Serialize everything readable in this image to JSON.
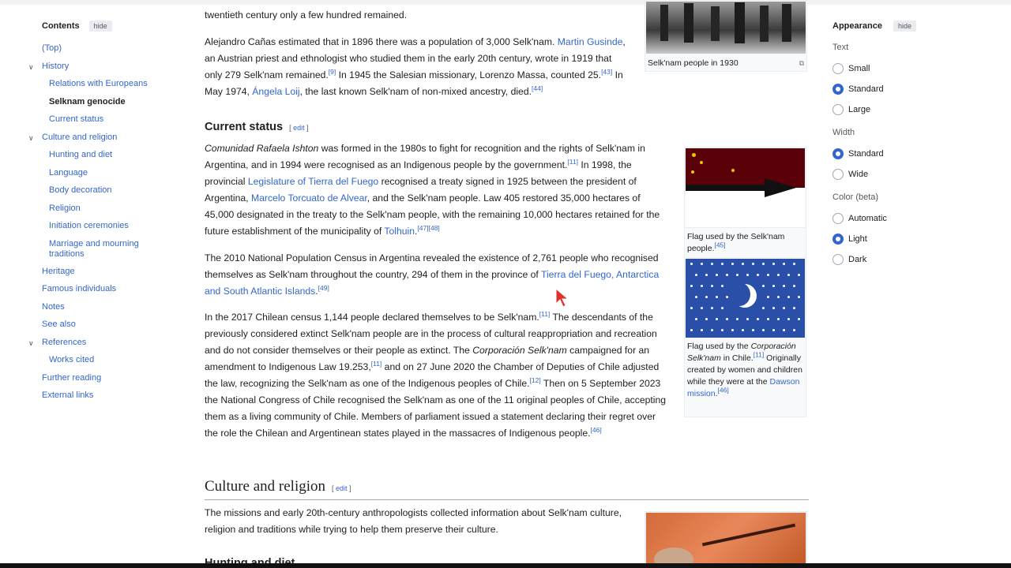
{
  "toc": {
    "title": "Contents",
    "hide": "hide",
    "items": [
      {
        "label": "(Top)",
        "level": "top"
      },
      {
        "label": "History",
        "level": "parent"
      },
      {
        "label": "Relations with Europeans",
        "level": "sub"
      },
      {
        "label": "Selknam genocide",
        "level": "sub-current"
      },
      {
        "label": "Current status",
        "level": "sub"
      },
      {
        "label": "Culture and religion",
        "level": "parent"
      },
      {
        "label": "Hunting and diet",
        "level": "sub"
      },
      {
        "label": "Language",
        "level": "sub"
      },
      {
        "label": "Body decoration",
        "level": "sub"
      },
      {
        "label": "Religion",
        "level": "sub"
      },
      {
        "label": "Initiation ceremonies",
        "level": "sub"
      },
      {
        "label": "Marriage and mourning traditions",
        "level": "sub-tall"
      },
      {
        "label": "Heritage",
        "level": "top"
      },
      {
        "label": "Famous individuals",
        "level": "top"
      },
      {
        "label": "Notes",
        "level": "top"
      },
      {
        "label": "See also",
        "level": "top"
      },
      {
        "label": "References",
        "level": "parent"
      },
      {
        "label": "Works cited",
        "level": "sub"
      },
      {
        "label": "Further reading",
        "level": "top"
      },
      {
        "label": "External links",
        "level": "top"
      }
    ]
  },
  "article": {
    "p0_tail": "twentieth century only a few hundred remained.",
    "p1": {
      "a": "Alejandro Cañas estimated that in 1896 there was a population of 3,000 Selk'nam. ",
      "link1": "Martin Gusinde",
      "b": ", an Austrian priest and ethnologist who studied them in the early 20th century, wrote in 1919 that only 279 Selk'nam remained.",
      "ref1": "[9]",
      "c": " In 1945 the Salesian missionary, Lorenzo Massa, counted 25.",
      "ref2": "[43]",
      "d": " In May 1974, ",
      "link2": "Ángela Loij",
      "e": ", the last known Selk'nam of non-mixed ancestry, died.",
      "ref3": "[44]"
    },
    "current_status": {
      "heading": "Current status",
      "edit_open": "[ ",
      "edit": "edit",
      "edit_close": " ]"
    },
    "p2": {
      "italic": "Comunidad Rafaela Ishton",
      "a": " was formed in the 1980s to fight for recognition and the rights of Selk'nam in Argentina, and in 1994 were recognised as an Indigenous people by the government.",
      "ref1": "[11]",
      "b": " In 1998, the provincial ",
      "link1": "Legislature of Tierra del Fuego",
      "c": " recognised a treaty signed in 1925 between the president of Argentina, ",
      "link2": "Marcelo Torcuato de Alvear",
      "d": ", and the Selk'nam people. Law 405 restored 35,000 hectares of 45,000 designated in the treaty to the Selk'nam people, with the remaining 10,000 hectares retained for the future establishment of the municipality of ",
      "link3": "Tolhuin",
      "e": ".",
      "ref2": "[47][48]"
    },
    "p3": {
      "a": "The 2010 National Population Census in Argentina revealed the existence of 2,761 people who recognised themselves as Selk'nam throughout the country, 294 of them in the province of ",
      "link1": "Tierra del Fuego, Antarctica and South Atlantic Islands",
      "b": ".",
      "ref1": "[49]"
    },
    "p4": {
      "a": "In the 2017 Chilean census 1,144 people declared themselves to be Selk'nam.",
      "ref1": "[11]",
      "b": " The descendants of the previously considered extinct Selk'nam people are in the process of cultural reappropriation and recreation and do not consider themselves or their people as extinct. The ",
      "italic": "Corporación Selk'nam",
      "c": " campaigned for an amendment to Indigenous Law 19.253,",
      "ref2": "[11]",
      "d": " and on 27 June 2020 the Chamber of Deputies of Chile adjusted the law, recognizing the Selk'nam as one of the Indigenous peoples of Chile.",
      "ref3": "[12]",
      "e": " Then on 5 September 2023 the National Congress of Chile recognised the Selk'nam as one of the 11 original peoples of Chile, accepting them as a living community of Chile. Members of parliament issued a statement declaring their regret over the role the Chilean and Argentinean states played in the massacres of Indigenous people.",
      "ref4": "[46]"
    },
    "culture": {
      "heading": "Culture and religion",
      "edit_open": "[ ",
      "edit": "edit",
      "edit_close": " ]"
    },
    "p5": "The missions and early 20th-century anthropologists collected information about Selk'nam culture, religion and traditions while trying to help them preserve their culture.",
    "next_heading_partial": "Hunting and diet"
  },
  "figures": {
    "photo1930": {
      "caption": "Selk'nam people in 1930"
    },
    "flag1": {
      "caption_a": "Flag used by the Selk'nam people.",
      "ref": "[45]"
    },
    "flag2": {
      "a": "Flag used by the ",
      "italic": "Corporación Selk'nam",
      "b": " in Chile.",
      "ref1": "[11]",
      "c": " Originally created by women and children while they were at the ",
      "link": "Dawson mission",
      "d": ".",
      "ref2": "[46]"
    }
  },
  "appearance": {
    "title": "Appearance",
    "hide": "hide",
    "text_label": "Text",
    "text_options": [
      "Small",
      "Standard",
      "Large"
    ],
    "text_selected": "Standard",
    "width_label": "Width",
    "width_options": [
      "Standard",
      "Wide"
    ],
    "width_selected": "Standard",
    "color_label": "Color (beta)",
    "color_options": [
      "Automatic",
      "Light",
      "Dark"
    ],
    "color_selected": "Light"
  },
  "colors": {
    "link": "#3366cc",
    "flag1_top": "#5a0008",
    "flag1_star": "#f5c400",
    "flag2_blue": "#2a4fa8"
  }
}
